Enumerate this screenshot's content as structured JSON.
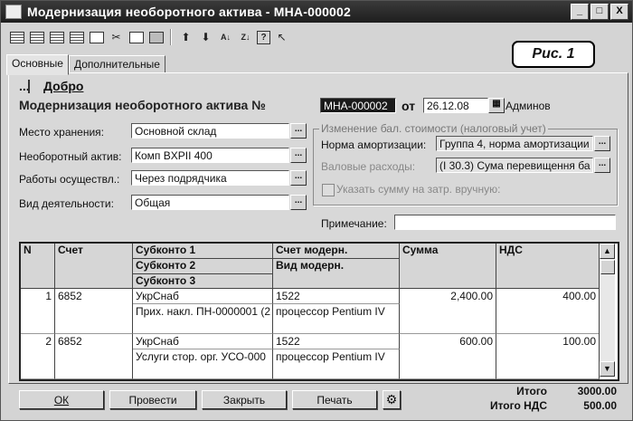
{
  "window": {
    "title": "Модернизация необоротного актива - МНА-000002",
    "controls": [
      "_",
      "□",
      "X"
    ]
  },
  "figure_label": "Рис. 1",
  "tabs": [
    {
      "label": "Основные",
      "active": true
    },
    {
      "label": "Дополнительные",
      "active": false
    }
  ],
  "header": {
    "ellipsis": "...",
    "link": "Добро",
    "doc_title": "Модернизация необоротного актива №",
    "doc_number": "МНА-000002",
    "date_label": "от",
    "date_value": "26.12.08",
    "author": "Админов"
  },
  "form": {
    "storage_label": "Место хранения:",
    "storage_value": "Основной склад",
    "asset_label": "Необоротный актив:",
    "asset_value": "Комп BXPII 400",
    "works_label": "Работы осуществл.:",
    "works_value": "Через подрядчика",
    "activity_label": "Вид деятельности:",
    "activity_value": "Общая",
    "note_label": "Примечание:",
    "note_value": ""
  },
  "tax_group": {
    "title": "Изменение бал. стоимости (налоговый учет)",
    "rate_label": "Норма амортизации:",
    "rate_value": "Группа 4, норма амортизации",
    "gross_label": "Валовые расходы:",
    "gross_value": "(I 30.3) Сума перевищення ба",
    "manual_label": "Указать сумму на затр. вручную:"
  },
  "grid": {
    "headers": {
      "n": "N",
      "account": "Счет",
      "sub1": "Субконто 1",
      "sub2": "Субконто 2",
      "sub3": "Субконто 3",
      "mod_account": "Счет модерн.",
      "mod_type": "Вид модерн.",
      "sum": "Сумма",
      "vat": "НДС"
    },
    "rows": [
      {
        "n": "1",
        "account": "6852",
        "sub1": "УкрСнаб",
        "sub2": "Прих. накл. ПН-0000001 (2",
        "mod_account": "1522",
        "mod_type": "процессор Pentium IV",
        "sum": "2,400.00",
        "vat": "400.00"
      },
      {
        "n": "2",
        "account": "6852",
        "sub1": "УкрСнаб",
        "sub2": "Услуги стор. орг. УСО-000",
        "mod_account": "1522",
        "mod_type": "процессор Pentium IV",
        "sum": "600.00",
        "vat": "100.00"
      }
    ]
  },
  "buttons": {
    "ok": "ОК",
    "post": "Провести",
    "close": "Закрыть",
    "print": "Печать"
  },
  "totals": {
    "total_label": "Итого",
    "total_value": "3000.00",
    "vat_label": "Итого НДС",
    "vat_value": "500.00"
  }
}
